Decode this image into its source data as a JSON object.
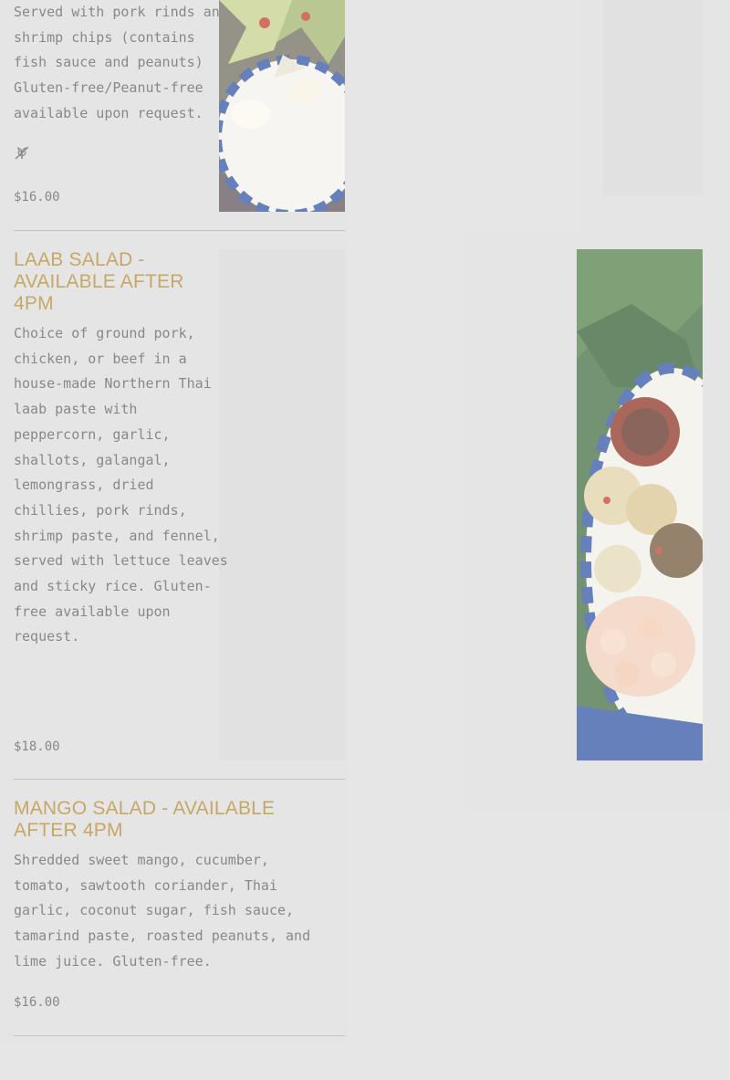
{
  "items": [
    {
      "description_tail": "Served with pork rinds and\nshrimp chips (contains\nfish sauce and peanuts)\nGluten-free/Peanut-free\navailable upon request.",
      "diet_icon": "gluten-free-icon",
      "price": "$16.00"
    },
    {
      "title": "LAAB SALAD - AVAILABLE AFTER 4PM",
      "description": "Choice of ground pork,\nchicken, or beef in a\nhouse-made Northern Thai\nlaab paste with\npeppercorn, garlic,\nshallots, galangal,\nlemongrass, dried\nchillies, pork rinds,\nshrimp paste, and fennel,\nserved with lettuce leaves\nand sticky rice. Gluten-\nfree available upon\nrequest.",
      "price": "$18.00"
    },
    {
      "title": "MANGO SALAD - AVAILABLE AFTER 4PM",
      "description": "Shredded sweet mango, cucumber,\ntomato, sawtooth coriander, Thai\ngarlic, coconut sugar, fish sauce,\ntamarind paste, roasted peanuts, and\nlime juice. Gluten-free.",
      "price": "$16.00"
    }
  ],
  "colors": {
    "title": "#b0852a",
    "text": "#5a5a5a",
    "divider": "#a9a9a9",
    "background": "#dcdcdc"
  }
}
